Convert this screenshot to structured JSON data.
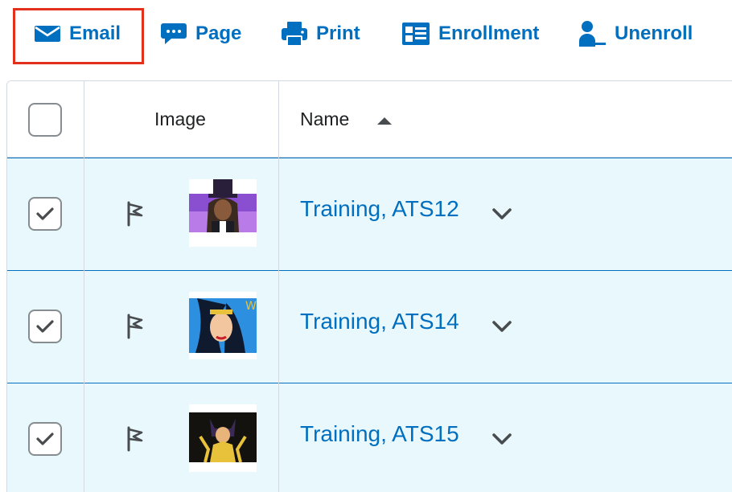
{
  "toolbar": {
    "buttons": [
      {
        "id": "email",
        "label": "Email",
        "icon": "envelope-icon",
        "highlighted": true
      },
      {
        "id": "page",
        "label": "Page",
        "icon": "chat-bubble-icon"
      },
      {
        "id": "print",
        "label": "Print",
        "icon": "printer-icon"
      },
      {
        "id": "enrollment",
        "label": "Enrollment",
        "icon": "id-card-icon"
      },
      {
        "id": "unenroll",
        "label": "Unenroll",
        "icon": "person-remove-icon"
      }
    ],
    "highlight_color": "#e3301d",
    "link_color": "#006fbf"
  },
  "table": {
    "headers": {
      "select_all_checked": false,
      "image": "Image",
      "name": "Name",
      "name_sort": "ascending"
    },
    "rows": [
      {
        "checked": true,
        "flag_icon": "flag-icon",
        "avatar": "purple-magician-avatar",
        "name": "Training, ATS12"
      },
      {
        "checked": true,
        "flag_icon": "flag-icon",
        "avatar": "blue-heroine-avatar",
        "name": "Training, ATS14"
      },
      {
        "checked": true,
        "flag_icon": "flag-icon",
        "avatar": "dark-bat-avatar",
        "name": "Training, ATS15"
      }
    ],
    "selected_row_bg": "#e8f8fd"
  }
}
